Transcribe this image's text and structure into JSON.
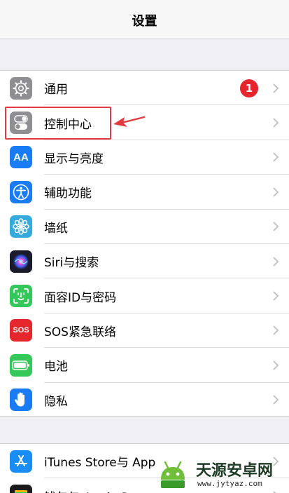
{
  "navbar": {
    "title": "设置"
  },
  "settings": [
    {
      "label": "通用",
      "icon": "gear-icon",
      "color": "#8e8e93",
      "badge": "1"
    },
    {
      "label": "控制中心",
      "icon": "toggle-switches-icon",
      "color": "#8e8e93"
    },
    {
      "label": "显示与亮度",
      "icon": "text-size-icon",
      "color": "#1a7cf5",
      "icon_text": "AA"
    },
    {
      "label": "辅助功能",
      "icon": "accessibility-person-icon",
      "color": "#1a7cf5"
    },
    {
      "label": "墙纸",
      "icon": "flower-icon",
      "color": "#35aadc"
    },
    {
      "label": "Siri与搜索",
      "icon": "siri-orb-icon",
      "color": "#1b1b2e"
    },
    {
      "label": "面容ID与密码",
      "icon": "face-id-icon",
      "color": "#34c759"
    },
    {
      "label": "SOS紧急联络",
      "icon": "sos-icon",
      "color": "#e5262c",
      "icon_text": "SOS"
    },
    {
      "label": "电池",
      "icon": "battery-icon",
      "color": "#34c759"
    },
    {
      "label": "隐私",
      "icon": "hand-icon",
      "color": "#1a7cf5"
    }
  ],
  "settings2": [
    {
      "label": "iTunes Store与 App",
      "icon": "app-store-icon",
      "color": "#1a8cf5"
    },
    {
      "label": "钱包与 Apple Pay",
      "icon": "wallet-icon",
      "color": "#1b1b1b"
    }
  ],
  "watermark": {
    "title": "天源安卓网",
    "url": "www.jytyaz.com"
  }
}
